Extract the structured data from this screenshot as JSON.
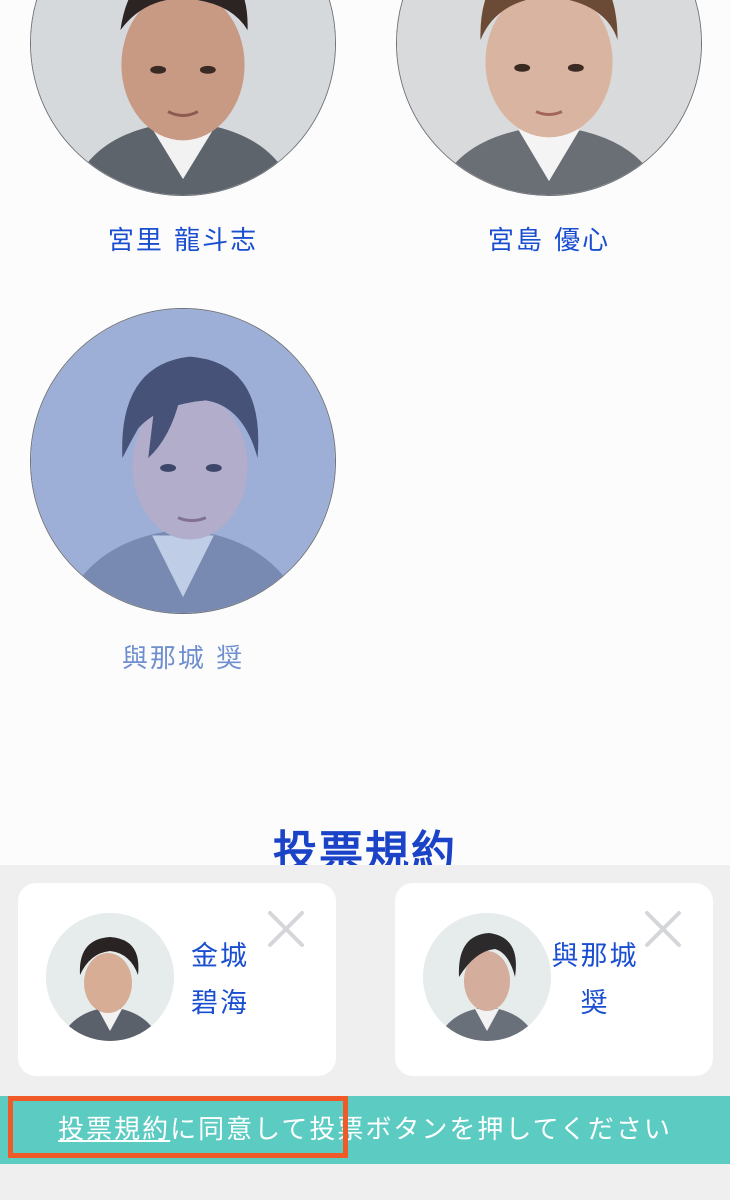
{
  "candidates": [
    {
      "name": "宮里 龍斗志"
    },
    {
      "name": "宮島 優心"
    },
    {
      "name": "與那城 奨"
    }
  ],
  "terms_heading": "投票規約",
  "selected": [
    {
      "line1": "金城",
      "line2": "碧海"
    },
    {
      "line1": "與那城",
      "line2": "奨"
    }
  ],
  "vote_instruction": {
    "link_text": "投票規約",
    "rest_text": "に同意して投票ボタンを押してください"
  },
  "colors": {
    "name_blue": "#1a4ed0",
    "selected_name": "#6f8fcf",
    "vote_bar": "#5ccbc2",
    "highlight": "#f05a28",
    "tray_bg": "#efefef"
  }
}
